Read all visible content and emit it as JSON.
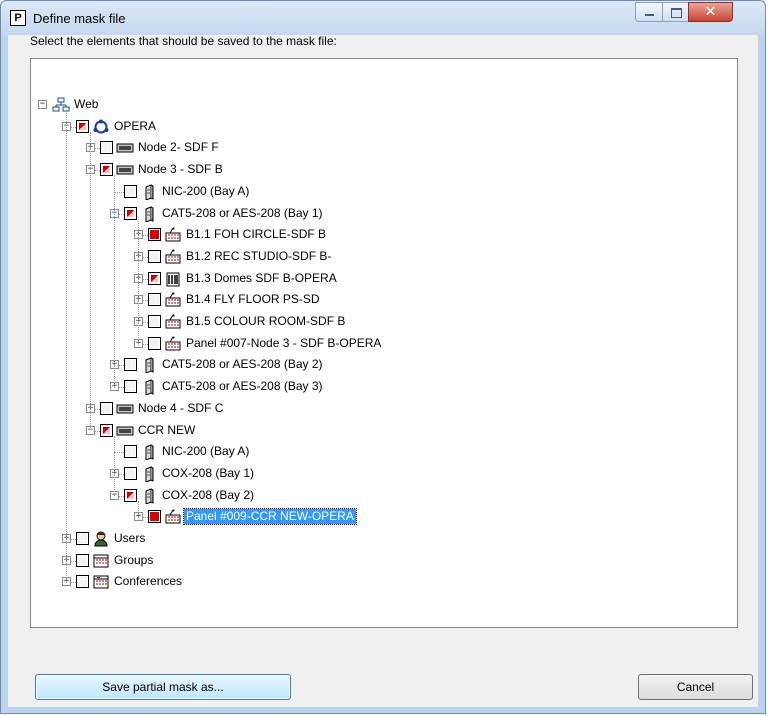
{
  "window": {
    "title": "Define mask file",
    "app_icon_letter": "P"
  },
  "instructions": "Select the elements that should be saved to the mask file:",
  "tree": [
    {
      "label": "Web",
      "depth": 0,
      "expander": "minus",
      "check": null,
      "icon": "network-icon"
    },
    {
      "label": "OPERA",
      "depth": 1,
      "expander": "minus",
      "check": "partial",
      "icon": "ring-node-icon"
    },
    {
      "label": "Node 2- SDF F",
      "depth": 2,
      "expander": "plus",
      "check": "none",
      "icon": "rack-node-icon"
    },
    {
      "label": "Node 3 - SDF B",
      "depth": 2,
      "expander": "minus",
      "check": "partial",
      "icon": "rack-node-icon"
    },
    {
      "label": "NIC-200 (Bay A)",
      "depth": 3,
      "expander": null,
      "check": "none",
      "icon": "card-icon"
    },
    {
      "label": "CAT5-208 or AES-208 (Bay  1)",
      "depth": 3,
      "expander": "minus",
      "check": "partial",
      "icon": "card-icon"
    },
    {
      "label": "B1.1 FOH CIRCLE-SDF B",
      "depth": 4,
      "expander": "plus",
      "check": "full",
      "icon": "intercom-panel-icon"
    },
    {
      "label": "B1.2 REC STUDIO-SDF B-",
      "depth": 4,
      "expander": "plus",
      "check": "none",
      "icon": "intercom-panel-icon"
    },
    {
      "label": "B1.3 Domes SDF B-OPERA",
      "depth": 4,
      "expander": "plus",
      "check": "partial",
      "icon": "beltpack-icon"
    },
    {
      "label": "B1.4 FLY FLOOR PS-SD",
      "depth": 4,
      "expander": "plus",
      "check": "none",
      "icon": "intercom-panel-icon"
    },
    {
      "label": "B1.5 COLOUR ROOM-SDF B",
      "depth": 4,
      "expander": "plus",
      "check": "none",
      "icon": "intercom-panel-icon"
    },
    {
      "label": "Panel #007-Node 3 - SDF B-OPERA",
      "depth": 4,
      "expander": "plus",
      "check": "none",
      "icon": "intercom-panel-icon"
    },
    {
      "label": "CAT5-208 or AES-208 (Bay  2)",
      "depth": 3,
      "expander": "plus",
      "check": "none",
      "icon": "card-icon"
    },
    {
      "label": "CAT5-208 or AES-208 (Bay  3)",
      "depth": 3,
      "expander": "plus",
      "check": "none",
      "icon": "card-icon"
    },
    {
      "label": "Node 4 - SDF C",
      "depth": 2,
      "expander": "plus",
      "check": "none",
      "icon": "rack-node-icon"
    },
    {
      "label": "CCR NEW",
      "depth": 2,
      "expander": "minus",
      "check": "partial",
      "icon": "rack-node-icon"
    },
    {
      "label": "NIC-200 (Bay A)",
      "depth": 3,
      "expander": null,
      "check": "none",
      "icon": "card-icon"
    },
    {
      "label": "COX-208 (Bay  1)",
      "depth": 3,
      "expander": "plus",
      "check": "none",
      "icon": "card-icon"
    },
    {
      "label": "COX-208 (Bay  2)",
      "depth": 3,
      "expander": "minus",
      "check": "partial",
      "icon": "card-icon"
    },
    {
      "label": "Panel #009-CCR NEW-OPERA",
      "depth": 4,
      "expander": "plus",
      "check": "full",
      "icon": "intercom-panel-icon",
      "selected": true
    },
    {
      "label": "Users",
      "depth": 1,
      "expander": "plus",
      "check": "none",
      "icon": "users-icon"
    },
    {
      "label": "Groups",
      "depth": 1,
      "expander": "plus",
      "check": "none",
      "icon": "groups-icon"
    },
    {
      "label": "Conferences",
      "depth": 1,
      "expander": "plus",
      "check": "none",
      "icon": "conferences-icon"
    }
  ],
  "buttons": {
    "save_partial": "Save partial mask as...",
    "cancel": "Cancel"
  }
}
